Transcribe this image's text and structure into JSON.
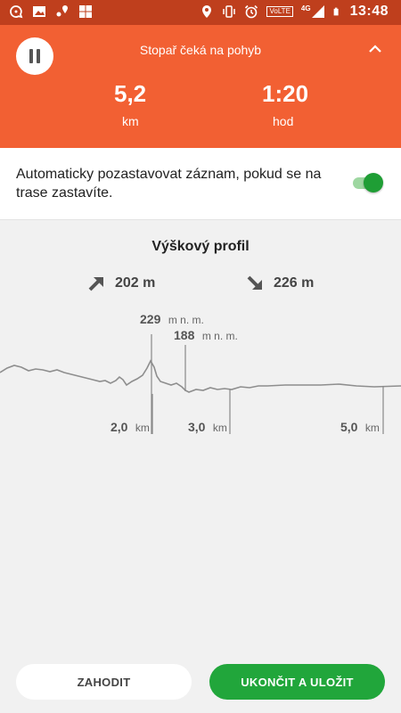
{
  "status_bar": {
    "time": "13:48",
    "volte": "VoLTE",
    "network": "4G",
    "icons": [
      "chat-icon",
      "image-icon",
      "location-pin-icon",
      "windows-icon",
      "location-icon",
      "vibrate-icon",
      "alarm-icon",
      "signal-icon",
      "battery-icon"
    ]
  },
  "tracker": {
    "status": "Stopař čeká na pohyb",
    "distance_value": "5,2",
    "distance_unit": "km",
    "time_value": "1:20",
    "time_unit": "hod"
  },
  "auto_pause": {
    "label": "Automaticky pozastavovat záznam, pokud se na trase zastavíte.",
    "enabled": true
  },
  "elevation": {
    "title": "Výškový profil",
    "ascent": "202 m",
    "descent": "226 m",
    "max_value": "229",
    "max_unit": "m n. m.",
    "min_value": "188",
    "min_unit": "m n. m.",
    "distance_markers": [
      {
        "value": "2,0",
        "unit": "km"
      },
      {
        "value": "3,0",
        "unit": "km"
      },
      {
        "value": "5,0",
        "unit": "km"
      }
    ]
  },
  "actions": {
    "discard_label": "ZAHODIT",
    "save_label": "UKONČIT A ULOŽIT"
  },
  "colors": {
    "header": "#f26033",
    "status_bar": "#bf3f1d",
    "accent_green": "#21a63b"
  }
}
